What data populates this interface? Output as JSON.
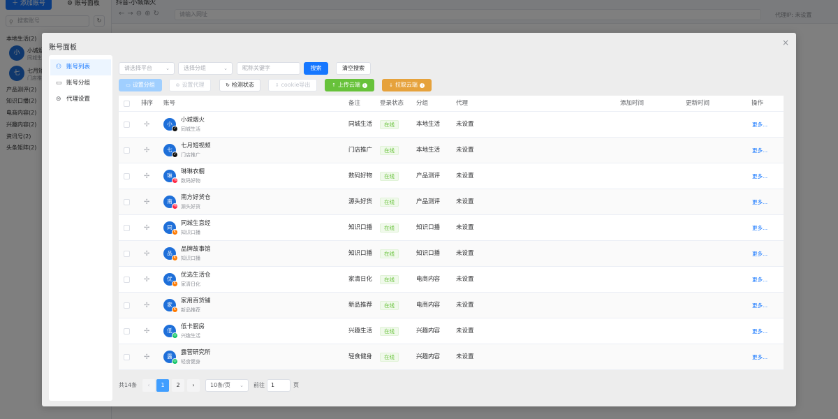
{
  "background": {
    "sidebar": {
      "add_button": "＋ 添加账号",
      "panel_button": "⚙ 账号面板",
      "search_placeholder": "搜索账号",
      "groups": [
        "本地生活(2)",
        "产品测评(2)",
        "知识口播(2)",
        "电商内容(2)",
        "兴趣内容(2)",
        "资讯号(2)",
        "头条矩阵(2)"
      ],
      "accounts": [
        {
          "avatar": "小",
          "name": "小城烟",
          "sub": "同城生"
        },
        {
          "avatar": "七",
          "name": "七月短",
          "sub": "门店推"
        }
      ]
    },
    "browser": {
      "tab_title": "抖音-小城烟火",
      "url_placeholder": "请输入网址",
      "proxy_text": "代理IP: 未设置"
    }
  },
  "dialog": {
    "title": "账号面板",
    "nav": [
      {
        "label": "账号列表",
        "icon": "user-icon",
        "active": true
      },
      {
        "label": "账号分组",
        "icon": "folder-icon",
        "active": false
      },
      {
        "label": "代理设置",
        "icon": "proxy-icon",
        "active": false
      }
    ],
    "filters": {
      "platform_placeholder": "请选择平台",
      "group_placeholder": "选择分组",
      "keyword_placeholder": "昵称关键字",
      "search_label": "搜索",
      "clear_label": "清空搜索"
    },
    "actions": {
      "set_group": "设置分组",
      "set_proxy": "设置代理",
      "check_status": "检测状态",
      "cookie_export": "cookie导出",
      "upload_cloud": "上传云端",
      "pull_cloud": "拉取云端"
    },
    "table": {
      "headers": {
        "sort": "排序",
        "account": "账号",
        "remark": "备注",
        "login_status": "登录状态",
        "group": "分组",
        "proxy": "代理",
        "added_time": "添加时间",
        "updated_time": "更新时间",
        "action": "操作"
      },
      "rows": [
        {
          "avatar": "小",
          "platform": "douyin",
          "name": "小城烟火",
          "sub": "同城生活",
          "remark": "同城生活",
          "status": "在线",
          "group": "本地生活",
          "proxy": "未设置",
          "more": "更多..."
        },
        {
          "avatar": "七",
          "platform": "douyin",
          "name": "七月短视频",
          "sub": "门店推广",
          "remark": "门店推广",
          "status": "在线",
          "group": "本地生活",
          "proxy": "未设置",
          "more": "更多..."
        },
        {
          "avatar": "琳",
          "platform": "xhs",
          "name": "琳琳衣橱",
          "sub": "数码好物",
          "remark": "数码好物",
          "status": "在线",
          "group": "产品测评",
          "proxy": "未设置",
          "more": "更多..."
        },
        {
          "avatar": "南",
          "platform": "xhs",
          "name": "南方好货仓",
          "sub": "源头好货",
          "remark": "源头好货",
          "status": "在线",
          "group": "产品测评",
          "proxy": "未设置",
          "more": "更多..."
        },
        {
          "avatar": "同",
          "platform": "ks",
          "name": "同城生意经",
          "sub": "知识口播",
          "remark": "知识口播",
          "status": "在线",
          "group": "知识口播",
          "proxy": "未设置",
          "more": "更多..."
        },
        {
          "avatar": "品",
          "platform": "ks",
          "name": "品牌故事馆",
          "sub": "知识口播",
          "remark": "知识口播",
          "status": "在线",
          "group": "知识口播",
          "proxy": "未设置",
          "more": "更多..."
        },
        {
          "avatar": "优",
          "platform": "ks",
          "name": "优选生活仓",
          "sub": "家清日化",
          "remark": "家清日化",
          "status": "在线",
          "group": "电商内容",
          "proxy": "未设置",
          "more": "更多..."
        },
        {
          "avatar": "家",
          "platform": "ks",
          "name": "家用百货铺",
          "sub": "新品推荐",
          "remark": "新品推荐",
          "status": "在线",
          "group": "电商内容",
          "proxy": "未设置",
          "more": "更多..."
        },
        {
          "avatar": "低",
          "platform": "wx",
          "name": "低卡厨房",
          "sub": "兴趣生活",
          "remark": "兴趣生活",
          "status": "在线",
          "group": "兴趣内容",
          "proxy": "未设置",
          "more": "更多..."
        },
        {
          "avatar": "露",
          "platform": "wx",
          "name": "露营研究所",
          "sub": "轻食健身",
          "remark": "轻食健身",
          "status": "在线",
          "group": "兴趣内容",
          "proxy": "未设置",
          "more": "更多..."
        }
      ]
    },
    "pagination": {
      "total": "共14条",
      "pages": [
        "1",
        "2"
      ],
      "current": "1",
      "page_size": "10条/页",
      "goto_label": "前往",
      "goto_value": "1",
      "goto_unit": "页"
    }
  }
}
